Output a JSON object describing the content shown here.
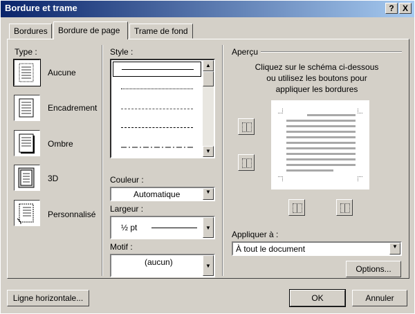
{
  "window": {
    "title": "Bordure et trame",
    "help_label": "?",
    "close_label": "X"
  },
  "tabs": [
    {
      "label": "Bordures",
      "active": false
    },
    {
      "label": "Bordure de page",
      "active": true
    },
    {
      "label": "Trame de fond",
      "active": false
    }
  ],
  "type": {
    "heading": "Type :",
    "options": [
      "Aucune",
      "Encadrement",
      "Ombre",
      "3D",
      "Personnalisé"
    ]
  },
  "style": {
    "heading": "Style :"
  },
  "couleur": {
    "label": "Couleur :",
    "value": "Automatique"
  },
  "largeur": {
    "label": "Largeur :",
    "value": "½ pt"
  },
  "motif": {
    "label": "Motif :",
    "value": "(aucun)"
  },
  "apercu": {
    "heading": "Aperçu",
    "instructions_1": "Cliquez sur le schéma ci-dessous",
    "instructions_2": "ou utilisez les boutons pour",
    "instructions_3": "appliquer les bordures"
  },
  "appliquer": {
    "label": "Appliquer à :",
    "value": "À tout le document"
  },
  "buttons": {
    "options": "Options...",
    "ligne_horizontale": "Ligne horizontale...",
    "ok": "OK",
    "annuler": "Annuler"
  }
}
